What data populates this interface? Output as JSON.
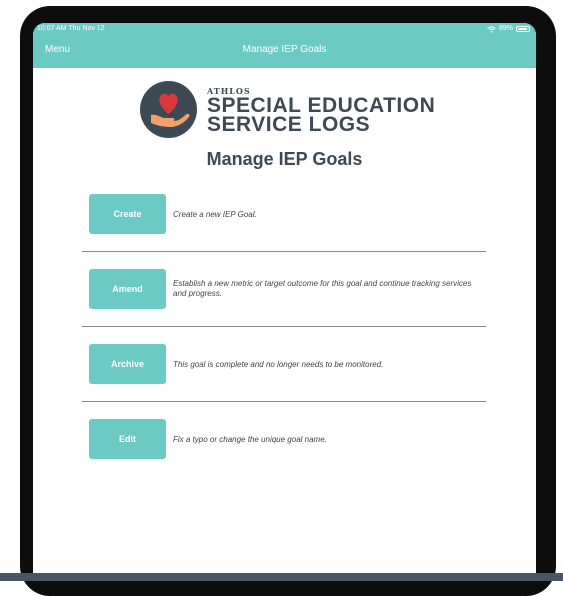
{
  "status_bar": {
    "time_date": "10:07 AM  Thu Nov 12",
    "battery_percent": "89%",
    "wifi_icon": "wifi-icon",
    "battery_level": 0.89
  },
  "nav": {
    "menu_label": "Menu",
    "title": "Manage IEP Goals"
  },
  "brand": {
    "small": "ATHLOS",
    "line1": "SPECIAL EDUCATION",
    "line2": "SERVICE LOGS",
    "logo_icon": "heart-in-hand-icon",
    "colors": {
      "logo_bg": "#3d4a55",
      "heart": "#d9393a",
      "hand": "#f2a266"
    }
  },
  "page": {
    "heading": "Manage IEP Goals"
  },
  "actions": [
    {
      "label": "Create",
      "description": "Create a new IEP Goal."
    },
    {
      "label": "Amend",
      "description": "Establish a new metric or target outcome for this goal and continue tracking services and progress."
    },
    {
      "label": "Archive",
      "description": "This goal is complete and no longer needs to be monitored."
    },
    {
      "label": "Edit",
      "description": "Fix a typo or change the unique goal name."
    }
  ],
  "colors": {
    "accent": "#6ccac4",
    "text_dark": "#3d4a55"
  }
}
